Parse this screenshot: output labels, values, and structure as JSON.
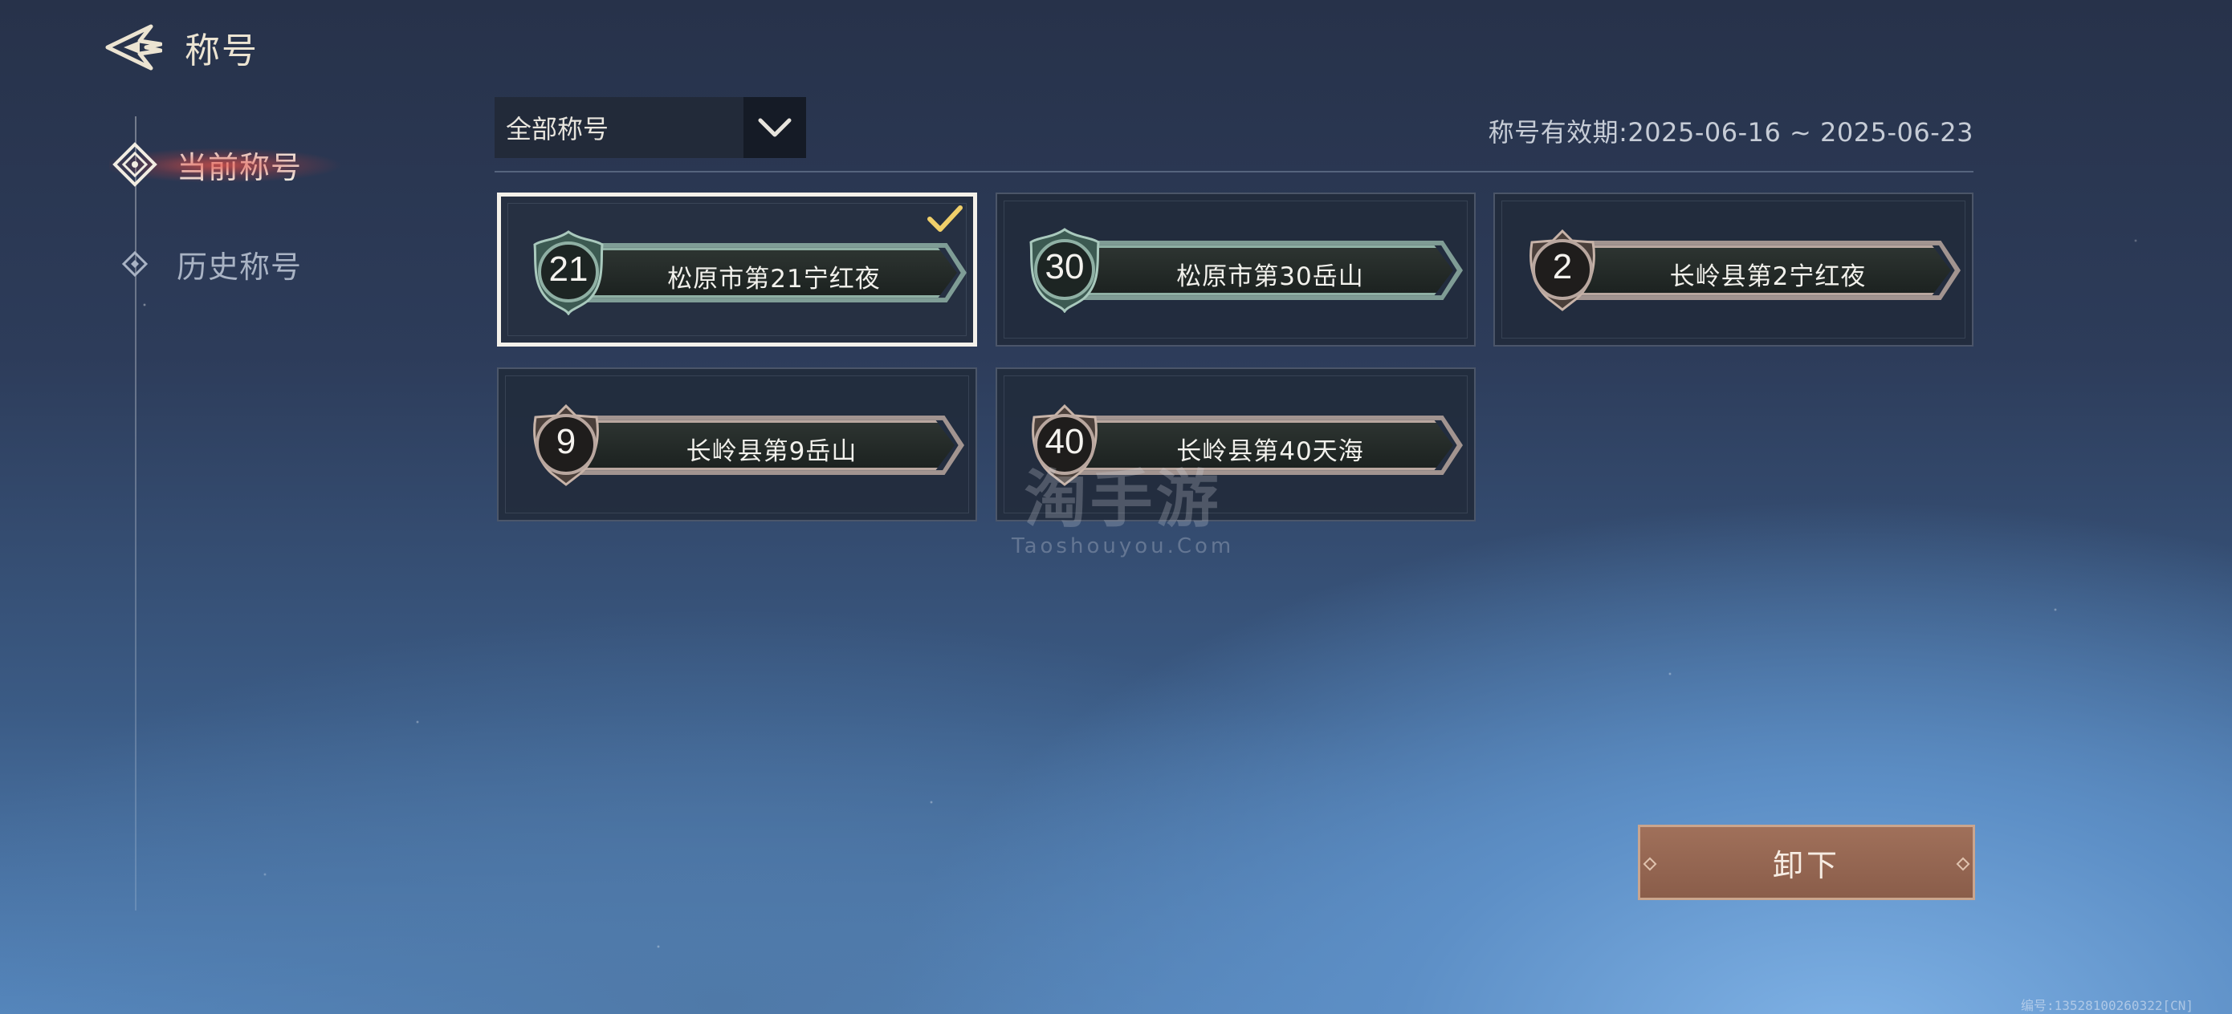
{
  "header": {
    "title": "称号",
    "back_icon": "back-arrow-icon"
  },
  "sidebar": {
    "items": [
      {
        "label": "当前称号",
        "active": true,
        "icon": "diamond-compass-icon"
      },
      {
        "label": "历史称号",
        "active": false,
        "icon": "small-diamond-icon"
      }
    ]
  },
  "filter": {
    "selected": "全部称号",
    "icon": "chevron-down-icon"
  },
  "validity": {
    "label": "称号有效期:",
    "range": "2025-06-16 ~ 2025-06-23"
  },
  "titles": [
    {
      "rank": "21",
      "name": "松原市第21宁红夜",
      "style": "jade",
      "selected": true
    },
    {
      "rank": "30",
      "name": "松原市第30岳山",
      "style": "jade",
      "selected": false
    },
    {
      "rank": "2",
      "name": "长岭县第2宁红夜",
      "style": "bronze",
      "selected": false
    },
    {
      "rank": "9",
      "name": "长岭县第9岳山",
      "style": "bronze",
      "selected": false
    },
    {
      "rank": "40",
      "name": "长岭县第40天海",
      "style": "bronze",
      "selected": false
    }
  ],
  "watermark": {
    "cn": "淘手游",
    "en": "Taoshouyou.Com"
  },
  "actions": {
    "unequip_label": "卸下"
  },
  "serial": "编号:13528100260322[CN]",
  "colors": {
    "jade_edge": "#8fb0a4",
    "bronze_edge": "#b9a79f",
    "button": "#8a5d4a",
    "active_glow": "#e65046"
  }
}
